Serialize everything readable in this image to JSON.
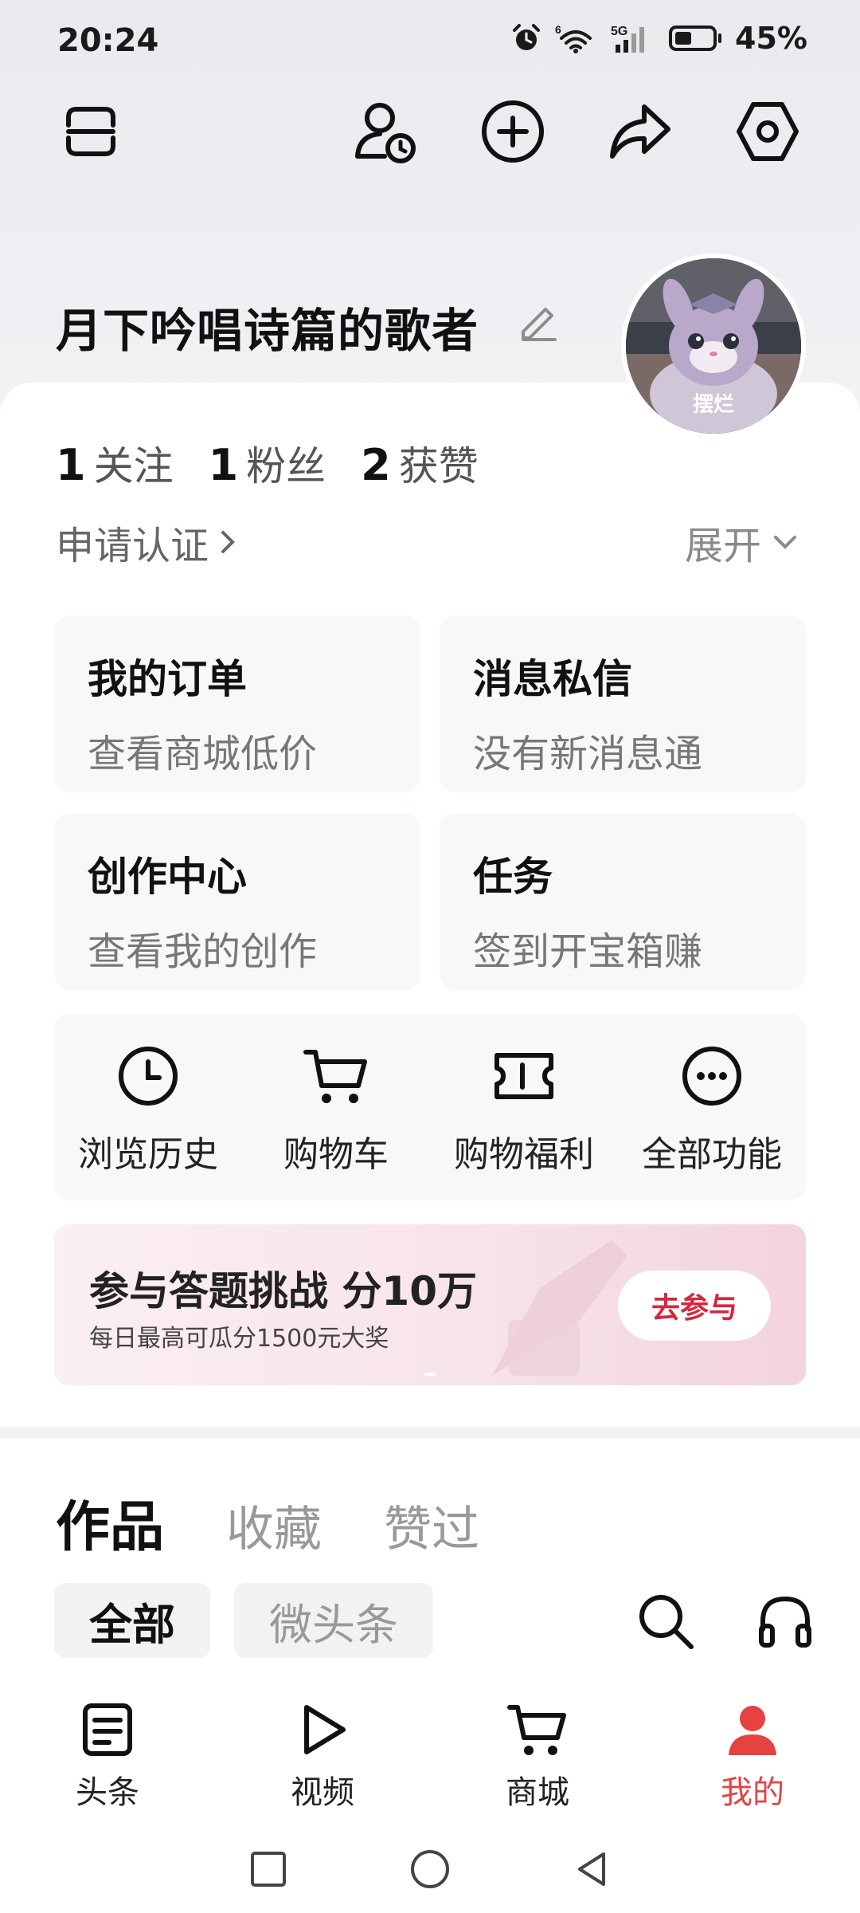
{
  "status_bar": {
    "time": "20:24",
    "wifi_tag": "6",
    "signal_tag": "5G",
    "battery_percent": "45%",
    "battery_level": 0.45
  },
  "toolbar": {
    "icons": [
      "scan-icon",
      "user-history-icon",
      "add-circle-icon",
      "share-icon",
      "settings-icon"
    ]
  },
  "profile": {
    "username": "月下吟唱诗篇的歌者",
    "avatar_label": "摆烂",
    "stats": [
      {
        "num": "1",
        "label": "关注"
      },
      {
        "num": "1",
        "label": "粉丝"
      },
      {
        "num": "2",
        "label": "获赞"
      }
    ],
    "apply_cert": "申请认证",
    "expand": "展开"
  },
  "tiles": [
    {
      "title": "我的订单",
      "sub": "查看商城低价"
    },
    {
      "title": "消息私信",
      "sub": "没有新消息通"
    },
    {
      "title": "创作中心",
      "sub": "查看我的创作"
    },
    {
      "title": "任务",
      "sub": "签到开宝箱赚"
    }
  ],
  "shortcuts": [
    {
      "icon": "clock-icon",
      "label": "浏览历史"
    },
    {
      "icon": "cart-icon",
      "label": "购物车"
    },
    {
      "icon": "ticket-icon",
      "label": "购物福利"
    },
    {
      "icon": "more-icon",
      "label": "全部功能"
    }
  ],
  "banner": {
    "title": "参与答题挑战 分10万",
    "sub": "每日最高可瓜分1500元大奖",
    "button": "去参与"
  },
  "works": {
    "tabs": [
      "作品",
      "收藏",
      "赞过"
    ],
    "chips": [
      "全部",
      "微头条"
    ]
  },
  "bottom_nav": [
    {
      "icon": "article-icon",
      "label": "头条"
    },
    {
      "icon": "video-icon",
      "label": "视频"
    },
    {
      "icon": "mall-icon",
      "label": "商城"
    },
    {
      "icon": "profile-icon",
      "label": "我的"
    }
  ],
  "colors": {
    "accent_red": "#e64242",
    "banner_button_red": "#d7263d"
  }
}
